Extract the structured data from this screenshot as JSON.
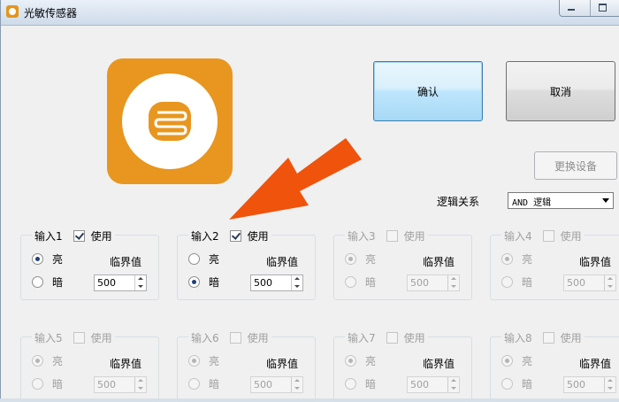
{
  "window": {
    "title": "光敏传感器"
  },
  "buttons": {
    "confirm": "确认",
    "cancel": "取消",
    "change_device": "更换设备"
  },
  "logic": {
    "label": "逻辑关系",
    "value": "AND 逻辑"
  },
  "accent_color": "#e8961f",
  "arrow_color": "#f0530c",
  "inputs": [
    {
      "title": "输入1",
      "use": "使用",
      "checked": true,
      "enabled": true,
      "bright": "亮",
      "dark": "暗",
      "selected": "bright",
      "threshold_label": "临界值",
      "threshold": "500"
    },
    {
      "title": "输入2",
      "use": "使用",
      "checked": true,
      "enabled": true,
      "bright": "亮",
      "dark": "暗",
      "selected": "dark",
      "threshold_label": "临界值",
      "threshold": "500"
    },
    {
      "title": "输入3",
      "use": "使用",
      "checked": false,
      "enabled": false,
      "bright": "亮",
      "dark": "暗",
      "selected": "bright",
      "threshold_label": "临界值",
      "threshold": "500"
    },
    {
      "title": "输入4",
      "use": "使用",
      "checked": false,
      "enabled": false,
      "bright": "亮",
      "dark": "暗",
      "selected": "bright",
      "threshold_label": "临界值",
      "threshold": "500"
    },
    {
      "title": "输入5",
      "use": "使用",
      "checked": false,
      "enabled": false,
      "bright": "亮",
      "dark": "暗",
      "selected": "bright",
      "threshold_label": "临界值",
      "threshold": "500"
    },
    {
      "title": "输入6",
      "use": "使用",
      "checked": false,
      "enabled": false,
      "bright": "亮",
      "dark": "暗",
      "selected": "bright",
      "threshold_label": "临界值",
      "threshold": "500"
    },
    {
      "title": "输入7",
      "use": "使用",
      "checked": false,
      "enabled": false,
      "bright": "亮",
      "dark": "暗",
      "selected": "bright",
      "threshold_label": "临界值",
      "threshold": "500"
    },
    {
      "title": "输入8",
      "use": "使用",
      "checked": false,
      "enabled": false,
      "bright": "亮",
      "dark": "暗",
      "selected": "bright",
      "threshold_label": "临界值",
      "threshold": "500"
    }
  ]
}
